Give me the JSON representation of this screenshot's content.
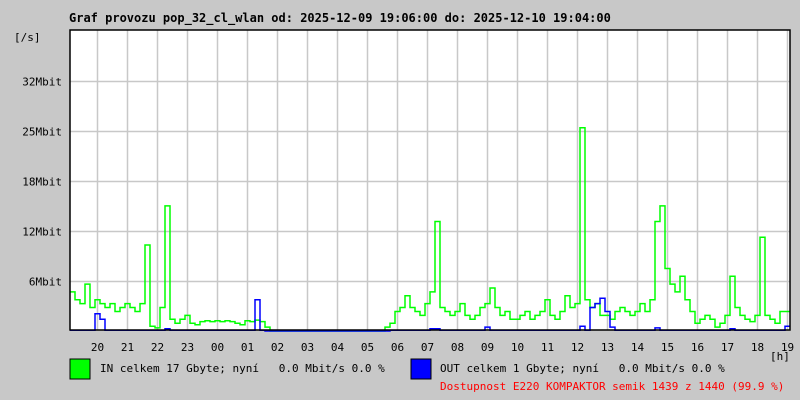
{
  "chart_data": {
    "type": "line",
    "title": "Graf provozu pop_32_cl_wlan od: 2025-12-09 19:06:00 do: 2025-12-10 19:04:00",
    "ylabel": "[/s]",
    "xlabel": "[h]",
    "x_start_hour": 19.1,
    "x_step_hours": 0.1666667,
    "ylim": [
      0,
      38.5
    ],
    "xlim_hours": [
      19.1,
      43.1
    ],
    "grid": true,
    "y_ticks": [
      {
        "value": 6.4,
        "label": "6Mbit"
      },
      {
        "value": 12.8,
        "label": "12Mbit"
      },
      {
        "value": 19.2,
        "label": "18Mbit"
      },
      {
        "value": 25.6,
        "label": "25Mbit"
      },
      {
        "value": 32.0,
        "label": "32Mbit"
      }
    ],
    "x_ticks": [
      {
        "hour": 20,
        "label": "20"
      },
      {
        "hour": 21,
        "label": "21"
      },
      {
        "hour": 22,
        "label": "22"
      },
      {
        "hour": 23,
        "label": "23"
      },
      {
        "hour": 24,
        "label": "00"
      },
      {
        "hour": 25,
        "label": "01"
      },
      {
        "hour": 26,
        "label": "02"
      },
      {
        "hour": 27,
        "label": "03"
      },
      {
        "hour": 28,
        "label": "04"
      },
      {
        "hour": 29,
        "label": "05"
      },
      {
        "hour": 30,
        "label": "06"
      },
      {
        "hour": 31,
        "label": "07"
      },
      {
        "hour": 32,
        "label": "08"
      },
      {
        "hour": 33,
        "label": "09"
      },
      {
        "hour": 34,
        "label": "10"
      },
      {
        "hour": 35,
        "label": "11"
      },
      {
        "hour": 36,
        "label": "12"
      },
      {
        "hour": 37,
        "label": "13"
      },
      {
        "hour": 38,
        "label": "14"
      },
      {
        "hour": 39,
        "label": "15"
      },
      {
        "hour": 40,
        "label": "16"
      },
      {
        "hour": 41,
        "label": "17"
      },
      {
        "hour": 42,
        "label": "18"
      },
      {
        "hour": 43,
        "label": "19"
      }
    ],
    "series": [
      {
        "name": "IN",
        "color": "#00ff00",
        "unit": "Mbit/s",
        "values": [
          5,
          4,
          3.5,
          6,
          3,
          4,
          3.5,
          3,
          3.5,
          2.5,
          3,
          3.5,
          3,
          2.5,
          3.5,
          11,
          0.6,
          0.4,
          3,
          16,
          1.5,
          1,
          1.5,
          2,
          1,
          0.8,
          1.2,
          1.3,
          1.2,
          1.3,
          1.2,
          1.3,
          1.2,
          1,
          0.8,
          1.3,
          1.2,
          1.4,
          1.2,
          0.5,
          0,
          0,
          0,
          0,
          0,
          0,
          0,
          0,
          0,
          0,
          0,
          0,
          0,
          0,
          0,
          0,
          0,
          0,
          0,
          0,
          0,
          0,
          0,
          0.5,
          1,
          2.5,
          3,
          4.5,
          3,
          2.5,
          2,
          3.5,
          5,
          14,
          3,
          2.5,
          2,
          2.5,
          3.5,
          2,
          1.5,
          2,
          3,
          3.5,
          5.5,
          3,
          2,
          2.5,
          1.5,
          1.5,
          2,
          2.5,
          1.5,
          2,
          2.5,
          4,
          2,
          1.5,
          2.5,
          4.5,
          3,
          3.5,
          26,
          4,
          3,
          3.5,
          2,
          2,
          1.5,
          2.5,
          3,
          2.5,
          2,
          2.5,
          3.5,
          2.5,
          4,
          14,
          16,
          8,
          6,
          5,
          7,
          4,
          2.5,
          1,
          1.5,
          2,
          1.5,
          0.5,
          1,
          2,
          7,
          3,
          2,
          1.5,
          1.2,
          2,
          12,
          2,
          1.5,
          1,
          2.5,
          2.5
        ]
      },
      {
        "name": "OUT",
        "color": "#0000ff",
        "unit": "Mbit/s",
        "values": [
          0.1,
          0.1,
          0.1,
          0.1,
          0.1,
          2.2,
          1.5,
          0.1,
          0.1,
          0.1,
          0.1,
          0.1,
          0.1,
          0.1,
          0.1,
          0.1,
          0.1,
          0.1,
          0.1,
          0.3,
          0.1,
          0.1,
          0.1,
          0.1,
          0.1,
          0.1,
          0.1,
          0.1,
          0.1,
          0.1,
          0.1,
          0.1,
          0.1,
          0.1,
          0.1,
          0.1,
          0.1,
          4,
          0.1,
          0,
          0,
          0,
          0,
          0,
          0,
          0,
          0,
          0,
          0,
          0,
          0,
          0,
          0,
          0,
          0,
          0,
          0,
          0,
          0,
          0,
          0,
          0,
          0,
          0,
          0.1,
          0.1,
          0.1,
          0.1,
          0.1,
          0.1,
          0.1,
          0.1,
          0.3,
          0.3,
          0.1,
          0.1,
          0.1,
          0.1,
          0.1,
          0.1,
          0.1,
          0.1,
          0.1,
          0.5,
          0.1,
          0.1,
          0.1,
          0.1,
          0.1,
          0.1,
          0.1,
          0.1,
          0.1,
          0.1,
          0.1,
          0.1,
          0.1,
          0.1,
          0.1,
          0.1,
          0.1,
          0.1,
          0.6,
          0.1,
          3,
          3.5,
          4.2,
          2.5,
          0.5,
          0.1,
          0.1,
          0.1,
          0.1,
          0.1,
          0.1,
          0.1,
          0.1,
          0.4,
          0.1,
          0.1,
          0.1,
          0.1,
          0.1,
          0.1,
          0.1,
          0.1,
          0.1,
          0.1,
          0.1,
          0.1,
          0.1,
          0.1,
          0.3,
          0.1,
          0.1,
          0.1,
          0.1,
          0.1,
          0.1,
          0.1,
          0.1,
          0.1,
          0.1,
          0.6
        ]
      }
    ]
  },
  "legend": {
    "in": {
      "color": "#00ff00",
      "text": "IN celkem 17 Gbyte; nyní   0.0 Mbit/s 0.0 %"
    },
    "out": {
      "color": "#0000ff",
      "text": "OUT celkem 1 Gbyte; nyní   0.0 Mbit/s 0.0 %"
    },
    "availability": "Dostupnost E220 KOMPAKTOR semik 1439 z 1440 (99.9 %)"
  }
}
